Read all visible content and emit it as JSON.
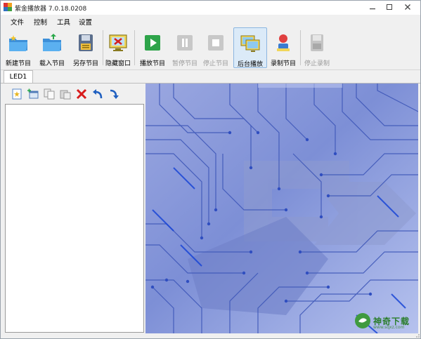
{
  "window": {
    "title": "紫金播放器 7.0.18.0208"
  },
  "menu": {
    "items": [
      "文件",
      "控制",
      "工具",
      "设置"
    ]
  },
  "toolbar": {
    "new_program": "新建节目",
    "load_program": "载入节目",
    "save_as_program": "另存节目",
    "hide_window": "隐藏窗口",
    "play_program": "播放节目",
    "pause_program": "暂停节目",
    "stop_program": "停止节目",
    "background_play": "后台播放",
    "record_program": "录制节目",
    "stop_record": "停止录制"
  },
  "tabs": [
    {
      "label": "LED1"
    }
  ],
  "watermark": {
    "text": "神奇下载",
    "sub": "www.sqxz.com"
  },
  "colors": {
    "accent": "#8cb6e0",
    "preview_bg": "#7d8fd6"
  }
}
